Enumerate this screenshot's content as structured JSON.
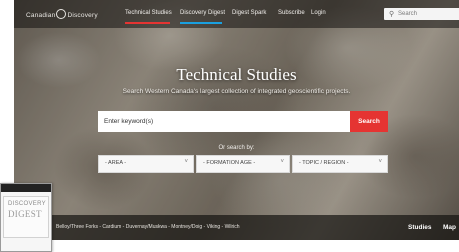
{
  "header": {
    "logo_text_left": "Canadian",
    "logo_text_right": "Discovery",
    "nav": [
      {
        "label": "Technical Studies",
        "accent": "#e53432",
        "active": true
      },
      {
        "label": "Discovery Digest",
        "accent": "#1aa0e0",
        "active": false
      },
      {
        "label": "Digest Spark",
        "accent": "",
        "active": false
      },
      {
        "label": "Subscribe",
        "accent": "",
        "active": false
      },
      {
        "label": "Login",
        "accent": "",
        "active": false
      }
    ],
    "search": {
      "icon": "search-icon",
      "placeholder": "Search"
    }
  },
  "hero": {
    "title": "Technical Studies",
    "subtitle": "Search Western Canada's largest collection of integrated geoscientific projects.",
    "keyword_placeholder": "Enter keyword(s)",
    "search_button": "Search",
    "or_search_by": "Or search by:",
    "filters": [
      {
        "label": "- AREA -"
      },
      {
        "label": "- FORMATION AGE -"
      },
      {
        "label": "- TOPIC / REGION -"
      }
    ]
  },
  "footer_bar": {
    "links_text": "Belloy/Three Forks - Cardium - Duvernay/Muskwa - Montney/Doig - Viking - Wilrich",
    "tabs": [
      "Studies",
      "Map"
    ]
  },
  "thumbnail": {
    "line1": "DISCOVERY",
    "line2": "DIGEST"
  },
  "colors": {
    "accent_red": "#e53432",
    "accent_blue": "#1aa0e0"
  }
}
